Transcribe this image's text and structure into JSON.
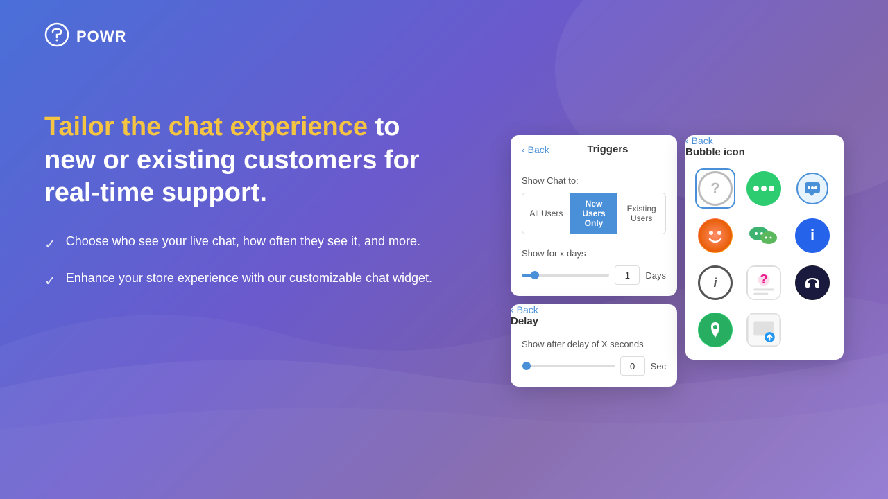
{
  "brand": {
    "name": "POWR"
  },
  "headline": {
    "highlight": "Tailor the chat experience",
    "normal": " to new or existing customers for real-time support."
  },
  "features": [
    {
      "text": "Choose who see your live chat, how often they see it, and more."
    },
    {
      "text": "Enhance your store experience with our customizable chat widget."
    }
  ],
  "triggers_panel": {
    "back_label": "Back",
    "title": "Triggers",
    "show_chat_label": "Show Chat to:",
    "toggle_options": [
      {
        "label": "All Users",
        "active": false
      },
      {
        "label": "New Users Only",
        "active": true
      },
      {
        "label": "Existing Users",
        "active": false
      }
    ],
    "show_for_label": "Show for x days",
    "slider_value": "1",
    "slider_unit": "Days"
  },
  "delay_panel": {
    "back_label": "Back",
    "title": "Delay",
    "show_after_label": "Show after delay of X seconds",
    "slider_value": "0",
    "slider_unit": "Sec"
  },
  "bubble_panel": {
    "back_label": "Back",
    "title": "Bubble icon",
    "icons": [
      {
        "name": "question-outline",
        "selected": true
      },
      {
        "name": "green-dots-chat"
      },
      {
        "name": "blue-speech-bubble"
      },
      {
        "name": "smiley-orange"
      },
      {
        "name": "wechat-green"
      },
      {
        "name": "info-circle-blue"
      },
      {
        "name": "info-outline-dark"
      },
      {
        "name": "question-pink"
      },
      {
        "name": "headset-dark"
      },
      {
        "name": "location-green"
      },
      {
        "name": "upload-image"
      }
    ]
  }
}
